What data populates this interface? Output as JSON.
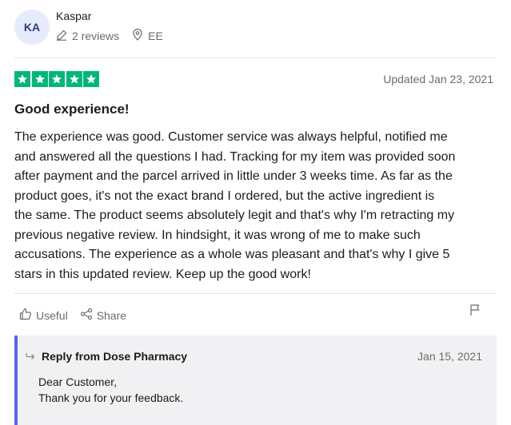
{
  "reviewer": {
    "initials": "KA",
    "name": "Kaspar",
    "reviews_count": "2 reviews",
    "country": "EE"
  },
  "review": {
    "rating": 5,
    "updated": "Updated Jan 23, 2021",
    "title": "Good experience!",
    "lines": [
      "The experience was good. Customer service was always helpful, notified me",
      "and answered all the questions I had. Tracking for my item was provided soon",
      "after payment and the parcel arrived in little under 3 weeks time. As far as the",
      "product goes, it's not the exact brand I ordered, but the active ingredient is",
      "the same. The product seems absolutely legit and that's why I'm retracting my",
      "previous negative review. In hindsight, it was wrong of me to make such",
      "accusations. The experience as a whole was pleasant and that's why I give 5",
      "stars in this updated review. Keep up the good work!"
    ]
  },
  "actions": {
    "useful_label": "Useful",
    "share_label": "Share"
  },
  "reply": {
    "from": "Reply from Dose Pharmacy",
    "date": "Jan 15, 2021",
    "lines": [
      "Dear Customer,",
      "Thank you for your feedback."
    ]
  },
  "colors": {
    "star_green": "#00b67a",
    "reply_accent": "#5862ef",
    "avatar_bg": "#e5ebfa"
  }
}
